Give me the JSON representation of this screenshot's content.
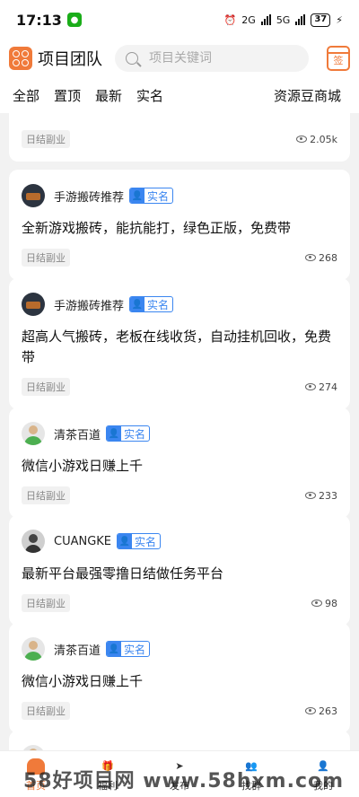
{
  "status_bar": {
    "time": "17:13",
    "net1": "2G",
    "net2": "5G",
    "battery": "37"
  },
  "header": {
    "app_title": "项目团队",
    "search_placeholder": "项目关键词",
    "checkin_label": "签"
  },
  "tabs": {
    "items": [
      "全部",
      "置顶",
      "最新",
      "实名"
    ],
    "store": "资源豆商城"
  },
  "posts": [
    {
      "author": "",
      "verified": "",
      "title": "",
      "tag": "日结副业",
      "views": "2.05k"
    },
    {
      "author": "手游搬砖推荐",
      "verified": "实名",
      "title": "全新游戏搬砖，能抗能打，绿色正版，免费带",
      "tag": "日结副业",
      "views": "268"
    },
    {
      "author": "手游搬砖推荐",
      "verified": "实名",
      "title": "超高人气搬砖，老板在线收货，自动挂机回收，免费带",
      "tag": "日结副业",
      "views": "274"
    },
    {
      "author": "清茶百道",
      "verified": "实名",
      "title": "微信小游戏日赚上千",
      "tag": "日结副业",
      "views": "233"
    },
    {
      "author": "CUANGKE",
      "verified": "实名",
      "title": "最新平台最强零撸日结做任务平台",
      "tag": "日结副业",
      "views": "98"
    },
    {
      "author": "清茶百道",
      "verified": "实名",
      "title": "微信小游戏日赚上千",
      "tag": "日结副业",
      "views": "263"
    }
  ],
  "tabbar": {
    "items": [
      "首页",
      "福利",
      "发布",
      "找群",
      "我的"
    ]
  },
  "watermark": "58好项目网 www.58hxm.com",
  "colors": {
    "accent": "#f07a3a",
    "verified": "#3b86f0"
  }
}
